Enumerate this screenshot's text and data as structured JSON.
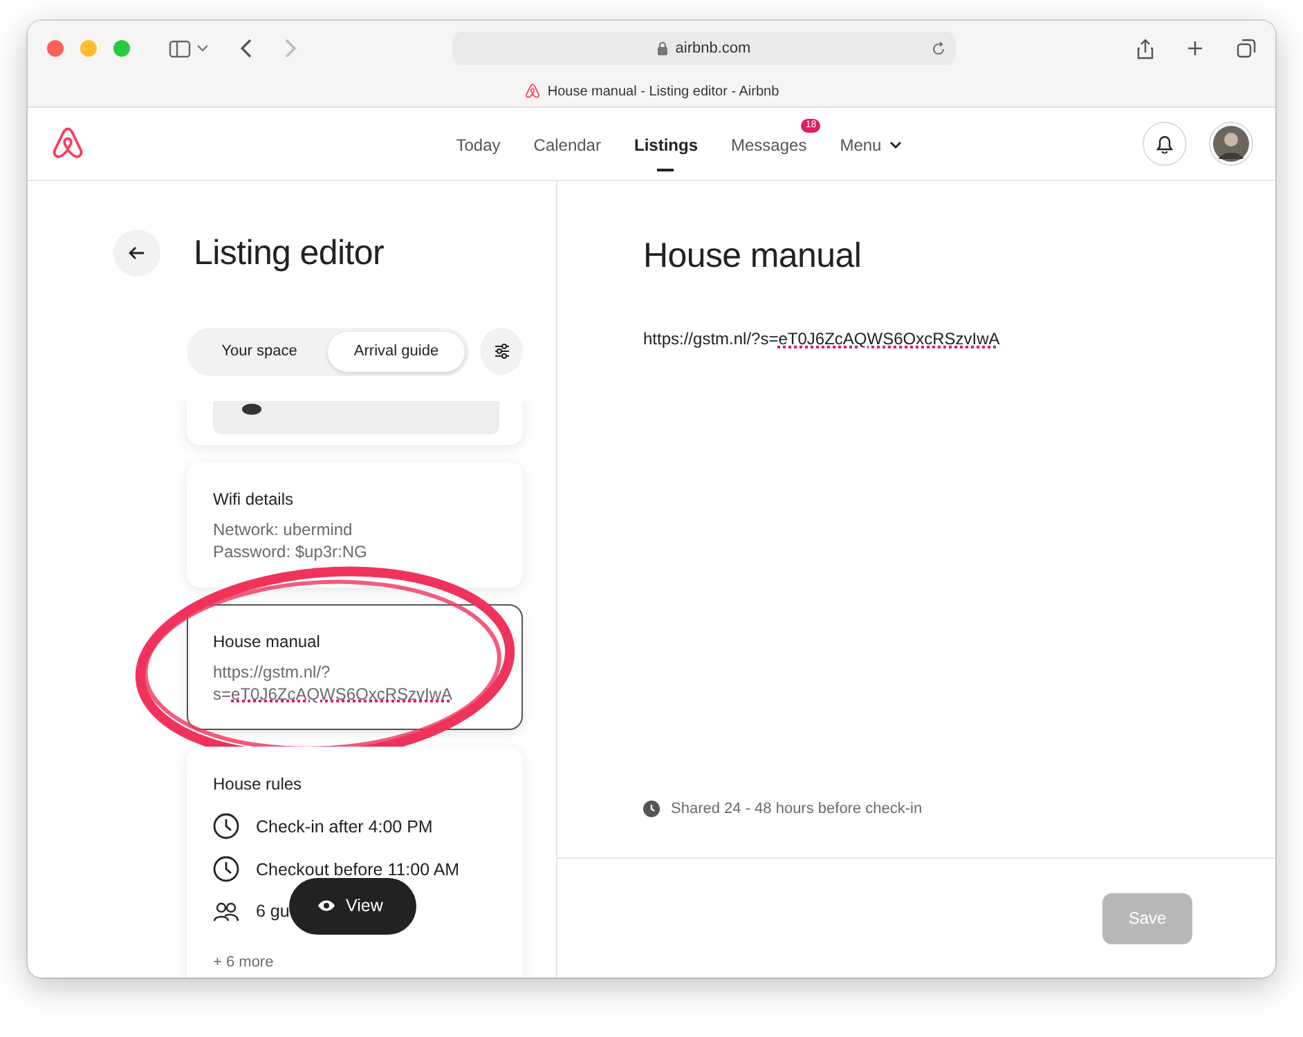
{
  "browser": {
    "address": "airbnb.com",
    "tab_title": "House manual - Listing editor - Airbnb"
  },
  "nav": {
    "items": [
      {
        "label": "Today",
        "selected": false,
        "kind": "link"
      },
      {
        "label": "Calendar",
        "selected": false,
        "kind": "link"
      },
      {
        "label": "Listings",
        "selected": true,
        "kind": "link"
      },
      {
        "label": "Messages",
        "selected": false,
        "kind": "link",
        "badge": "18"
      },
      {
        "label": "Menu",
        "selected": false,
        "kind": "dropdown"
      }
    ]
  },
  "editor": {
    "title": "Listing editor",
    "tabs": [
      {
        "label": "Your space",
        "selected": false
      },
      {
        "label": "Arrival guide",
        "selected": true
      }
    ],
    "cards": [
      {
        "kind": "picture",
        "selected": false
      },
      {
        "kind": "text",
        "title": "Wifi details",
        "lines": [
          "Network: ubermind",
          "Password: $up3r:NG"
        ],
        "selected": false
      },
      {
        "kind": "link",
        "title": "House manual",
        "annotated": true,
        "selected": true,
        "parts": [
          {
            "text": "https://gstm.nl/?s=",
            "misspelled": false
          },
          {
            "text": "eT0J6ZcAQWS6OxcRSzvIwA",
            "misspelled": true
          }
        ]
      },
      {
        "kind": "rules",
        "title": "House rules",
        "selected": false,
        "rules": [
          {
            "kind": "clock",
            "text": "Check-in after 4:00 PM"
          },
          {
            "kind": "clock",
            "text": "Checkout before 11:00 AM"
          },
          {
            "kind": "people",
            "text": "6 gu"
          }
        ],
        "more": "+ 6 more"
      }
    ],
    "view_button": "View"
  },
  "detail": {
    "title": "House manual",
    "parts": [
      {
        "text": "https://gstm.nl/?s=",
        "misspelled": false
      },
      {
        "text": "eT0J6ZcAQWS6OxcRSzvIwA",
        "misspelled": true
      }
    ],
    "note": "Shared 24 - 48 hours before check-in",
    "save": {
      "label": "Save",
      "disabled": true
    }
  }
}
